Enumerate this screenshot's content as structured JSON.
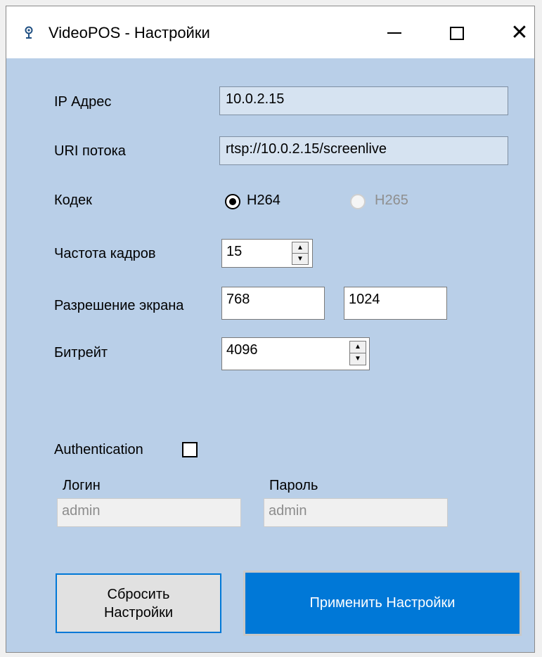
{
  "window": {
    "title": "VideoPOS - Настройки",
    "icon": "app-logo-icon",
    "controls": {
      "minimize": "—",
      "maximize": "☐",
      "close": "✕"
    }
  },
  "form": {
    "ip": {
      "label": "IP Адрес",
      "value": "10.0.2.15"
    },
    "uri": {
      "label": "URI потока",
      "value": "rtsp://10.0.2.15/screenlive"
    },
    "codec": {
      "label": "Кодек",
      "options": [
        {
          "label": "H264",
          "selected": true,
          "enabled": true
        },
        {
          "label": "H265",
          "selected": false,
          "enabled": false
        }
      ]
    },
    "framerate": {
      "label": "Частота кадров",
      "value": "15"
    },
    "resolution": {
      "label": "Разрешение экрана",
      "width": "768",
      "height": "1024"
    },
    "bitrate": {
      "label": "Битрейт",
      "value": "4096"
    },
    "auth": {
      "label": "Authentication",
      "checked": false,
      "login_label": "Логин",
      "login_value": "admin",
      "password_label": "Пароль",
      "password_value": "admin"
    }
  },
  "buttons": {
    "reset_line1": "Сбросить",
    "reset_line2": "Настройки",
    "apply": "Применить Настройки"
  },
  "colors": {
    "window_bg": "#b9cfe8",
    "accent": "#0078d7",
    "field_bg": "#d6e3f1"
  }
}
